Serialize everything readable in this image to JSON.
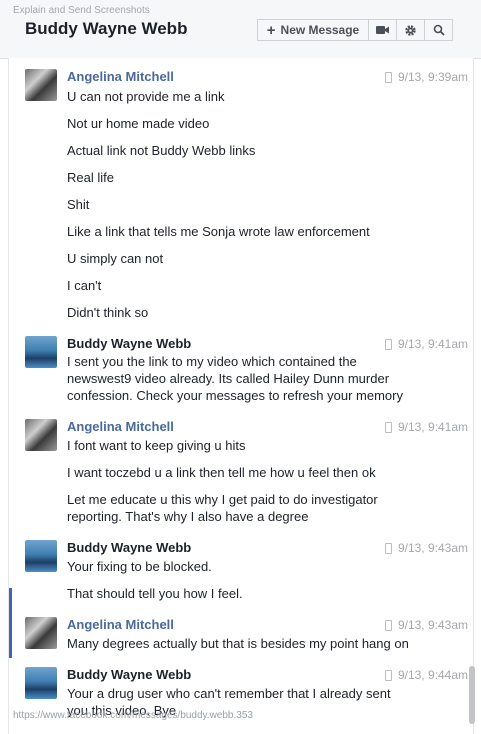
{
  "watermark": "Explain and Send Screenshots",
  "conversation": {
    "title": "Buddy Wayne Webb",
    "new_message_label": "New Message",
    "icons": [
      "video-camera-icon",
      "gear-icon",
      "search-icon"
    ]
  },
  "status_url": "https://www.facebook.com/messages/buddy.webb.353",
  "groups": [
    {
      "author": "Angelina Mitchell",
      "time": "9/13, 9:39am",
      "messages": [
        "U can not provide me a link",
        "Not ur home made video",
        "Actual link not Buddy Webb links",
        "Real life",
        "Shit",
        "Like a link that tells me Sonja wrote law enforcement",
        "U simply can not",
        "I can't",
        "Didn't think so"
      ]
    },
    {
      "author": "Buddy Wayne Webb",
      "time": "9/13, 9:41am",
      "messages": [
        "I sent you the link to my video which contained the newswest9 video already. Its called Hailey Dunn murder confession. Check your messages to refresh your memory"
      ]
    },
    {
      "author": "Angelina Mitchell",
      "time": "9/13, 9:41am",
      "messages": [
        "I font want to keep giving u hits",
        "I want toczebd u a link then tell me how u feel then ok",
        "Let me educate u this why I get paid to do investigator reporting. That's why I also have a degree"
      ]
    },
    {
      "author": "Buddy Wayne Webb",
      "time": "9/13, 9:43am",
      "messages": [
        "Your fixing to be blocked.",
        "That should tell you how I feel."
      ]
    },
    {
      "author": "Angelina Mitchell",
      "time": "9/13, 9:43am",
      "messages": [
        "Many degrees actually but that is besides my point hang on"
      ]
    },
    {
      "author": "Buddy Wayne Webb",
      "time": "9/13, 9:44am",
      "messages": [
        "Your a drug user who can't remember that I already sent you this video. Bye"
      ]
    }
  ]
}
